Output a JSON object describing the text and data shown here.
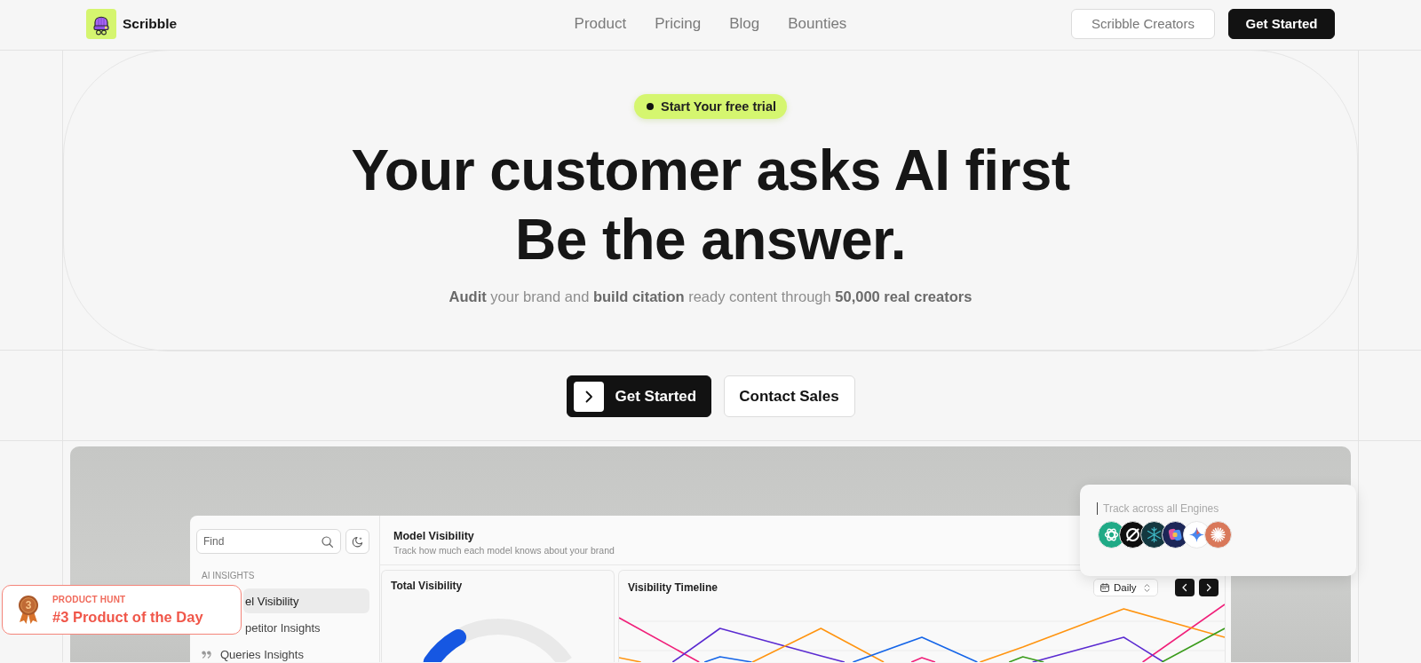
{
  "nav": {
    "logo_text": "Scribble",
    "links": [
      {
        "label": "Product"
      },
      {
        "label": "Pricing"
      },
      {
        "label": "Blog"
      },
      {
        "label": "Bounties"
      }
    ],
    "buttons": [
      {
        "label": "Scribble Creators",
        "kind": "outline"
      },
      {
        "label": "Get Started",
        "kind": "primary"
      }
    ]
  },
  "hero": {
    "badge": "Start Your free trial",
    "headline": [
      "Your customer asks AI first",
      "Be the answer."
    ],
    "subtitle": "**Audit** your brand and **build citation** ready content through **50,000 real creators**"
  },
  "cta": [
    {
      "label": "Get Started",
      "kind": "primary"
    },
    {
      "label": "Contact Sales",
      "kind": "outline"
    }
  ],
  "preview": {
    "sidebar": {
      "search": {
        "placeholder": "Find"
      },
      "section": "AI INSIGHTS",
      "items": [
        {
          "label": "el Visibility",
          "selected": true,
          "icon": false
        },
        {
          "label": "petitor Insights",
          "selected": false,
          "icon": false
        },
        {
          "label": "Queries Insights",
          "selected": false,
          "icon": true
        }
      ]
    },
    "header": {
      "title": "Model Visibility",
      "subtitle": "Track how much each model knows about your brand"
    },
    "total_card": {
      "title": "Total Visibility"
    },
    "timeline_card": {
      "title": "Visibility Timeline",
      "period": "Daily"
    },
    "engines_card": {
      "placeholder": "Track across all Engines"
    }
  },
  "product_hunt": {
    "eyebrow": "PRODUCT HUNT",
    "rank": "3",
    "title": "#3 Product of the Day"
  }
}
